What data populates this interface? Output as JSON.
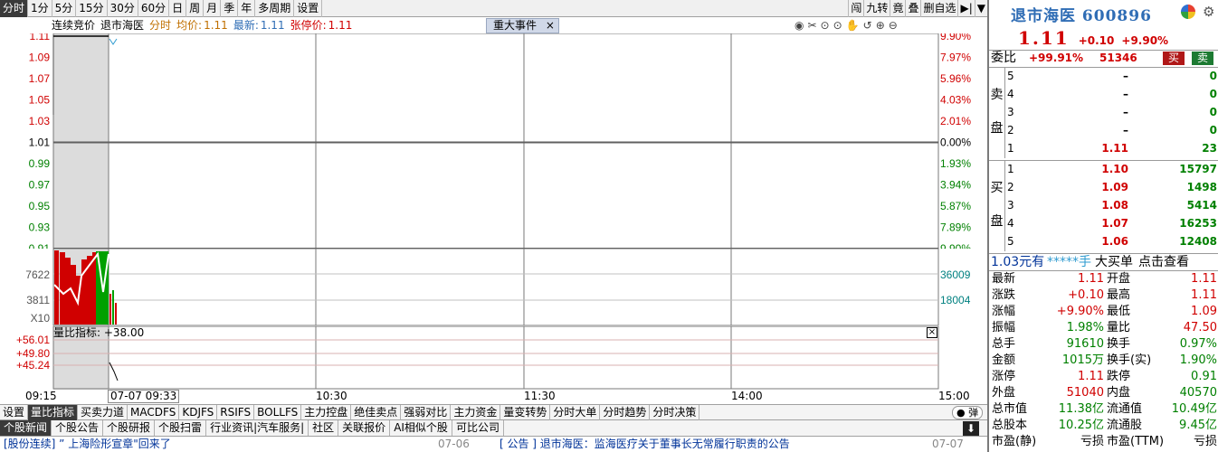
{
  "toolbar": {
    "periods": [
      "分时",
      "1分",
      "5分",
      "15分",
      "30分",
      "60分",
      "日",
      "周",
      "月",
      "季",
      "年",
      "多周期",
      "设置"
    ],
    "right_tools": [
      "闯",
      "九转",
      "竟",
      "叠",
      "删自选"
    ]
  },
  "chart_header": {
    "mode": "连续竞价",
    "name": "退市海医",
    "intraday": "分时",
    "avg_label": "均价:",
    "avg_value": "1.11",
    "latest_label": "最新:",
    "latest_value": "1.11",
    "limit_up_label": "张停价:",
    "limit_up_value": "1.11",
    "major_event": "重大事件",
    "major_event_close": "×"
  },
  "chart_tools": [
    "◉",
    "✂",
    "⊙",
    "⊙",
    "✋",
    "↺",
    "⊕",
    "⊖"
  ],
  "price_axis": {
    "left": [
      "1.11",
      "1.09",
      "1.07",
      "1.05",
      "1.03",
      "1.01",
      "0.99",
      "0.97",
      "0.95",
      "0.93",
      "0.91"
    ],
    "right": [
      "9.90%",
      "7.97%",
      "5.96%",
      "4.03%",
      "2.01%",
      "0.00%",
      "1.93%",
      "3.94%",
      "5.87%",
      "7.89%",
      "9.90%"
    ]
  },
  "volume_axis": {
    "left": [
      "7622",
      "3811",
      "X10"
    ],
    "right": [
      "36009",
      "18004"
    ]
  },
  "indicator": {
    "label": "量比指标: +38.00",
    "left_ticks": [
      "+56.01",
      "+49.80",
      "+45.24"
    ],
    "close": "×"
  },
  "time_axis": {
    "ticks": [
      "09:15",
      "09",
      "10:30",
      "11:30",
      "14:00",
      "15:00"
    ],
    "crosshair": "07-07 09:33"
  },
  "indicator_tabs": [
    "设置",
    "量比指标",
    "买卖力道",
    "MACDFS",
    "KDJFS",
    "RSIFS",
    "BOLLFS",
    "主力控盘",
    "绝佳卖点",
    "强弱对比",
    "主力资金",
    "量变转势",
    "分时大单",
    "分时趋势",
    "分时决策"
  ],
  "bullet_label": "● 弹",
  "news_tabs": [
    "个股新闻",
    "个股公告",
    "个股研报",
    "个股扫雷",
    "行业资讯|汽车服务|",
    "社区",
    "关联报价",
    "AI相似个股",
    "可比公司"
  ],
  "news_strip": {
    "left": "[股份连续] ” 上海险形宣章\"回来了",
    "left_time": "07-06",
    "right": "[ 公告 ] 退市海医：监海医疗关于董事长无常履行职责的公告",
    "right_time": "07-07"
  },
  "quote": {
    "name": "退市海医",
    "code": "600896",
    "last": "1.11",
    "change": "+0.10",
    "change_pct": "+9.90%",
    "weibi_label": "委比",
    "weibi_pct": "+99.91%",
    "weibi_diff": "51346",
    "buy_btn": "买",
    "sell_btn": "卖",
    "sell_side_label": [
      "卖",
      "盘"
    ],
    "buy_side_label": [
      "买",
      "盘"
    ],
    "asks": [
      {
        "level": "5",
        "price": "–",
        "vol": "0"
      },
      {
        "level": "4",
        "price": "–",
        "vol": "0"
      },
      {
        "level": "3",
        "price": "–",
        "vol": "0"
      },
      {
        "level": "2",
        "price": "–",
        "vol": "0"
      },
      {
        "level": "1",
        "price": "1.11",
        "vol": "23"
      }
    ],
    "bids": [
      {
        "level": "1",
        "price": "1.10",
        "vol": "15797"
      },
      {
        "level": "2",
        "price": "1.09",
        "vol": "1498"
      },
      {
        "level": "3",
        "price": "1.08",
        "vol": "5414"
      },
      {
        "level": "4",
        "price": "1.07",
        "vol": "16253"
      },
      {
        "level": "5",
        "price": "1.06",
        "vol": "12408"
      }
    ],
    "bigbuy": {
      "price": "1.03元有",
      "hands": "*****手",
      "label": "大买单",
      "link": "点击查看"
    },
    "stats": [
      {
        "l1": "最新",
        "v1": "1.11",
        "c1": "#d00000",
        "l2": "开盘",
        "v2": "1.11",
        "c2": "#d00000"
      },
      {
        "l1": "涨跌",
        "v1": "+0.10",
        "c1": "#d00000",
        "l2": "最高",
        "v2": "1.11",
        "c2": "#d00000"
      },
      {
        "l1": "涨幅",
        "v1": "+9.90%",
        "c1": "#d00000",
        "l2": "最低",
        "v2": "1.09",
        "c2": "#d00000"
      },
      {
        "l1": "振幅",
        "v1": "1.98%",
        "c1": "#008000",
        "l2": "量比",
        "v2": "47.50",
        "c2": "#d00000"
      },
      {
        "l1": "总手",
        "v1": "91610",
        "c1": "#008000",
        "l2": "换手",
        "v2": "0.97%",
        "c2": "#008000"
      },
      {
        "l1": "金额",
        "v1": "1015万",
        "c1": "#008000",
        "l2": "换手(实)",
        "v2": "1.90%",
        "c2": "#008000"
      },
      {
        "l1": "涨停",
        "v1": "1.11",
        "c1": "#d00000",
        "l2": "跌停",
        "v2": "0.91",
        "c2": "#008000"
      },
      {
        "l1": "外盘",
        "v1": "51040",
        "c1": "#d00000",
        "l2": "内盘",
        "v2": "40570",
        "c2": "#008000"
      },
      {
        "l1": "总市值",
        "v1": "11.38亿",
        "c1": "#008000",
        "l2": "流通值",
        "v2": "10.49亿",
        "c2": "#008000"
      },
      {
        "l1": "总股本",
        "v1": "10.25亿",
        "c1": "#008000",
        "l2": "流通股",
        "v2": "9.45亿",
        "c2": "#008000"
      },
      {
        "l1": "市盈(静)",
        "v1": "亏损",
        "c1": "#000000",
        "l2": "市盈(TTM)",
        "v2": "亏损",
        "c2": "#000000"
      }
    ]
  },
  "colors": {
    "up": "#d00000",
    "down": "#008000",
    "grid": "#7a7a7a",
    "shade": "#dcdcdc",
    "title_blue": "#2f6db5"
  }
}
